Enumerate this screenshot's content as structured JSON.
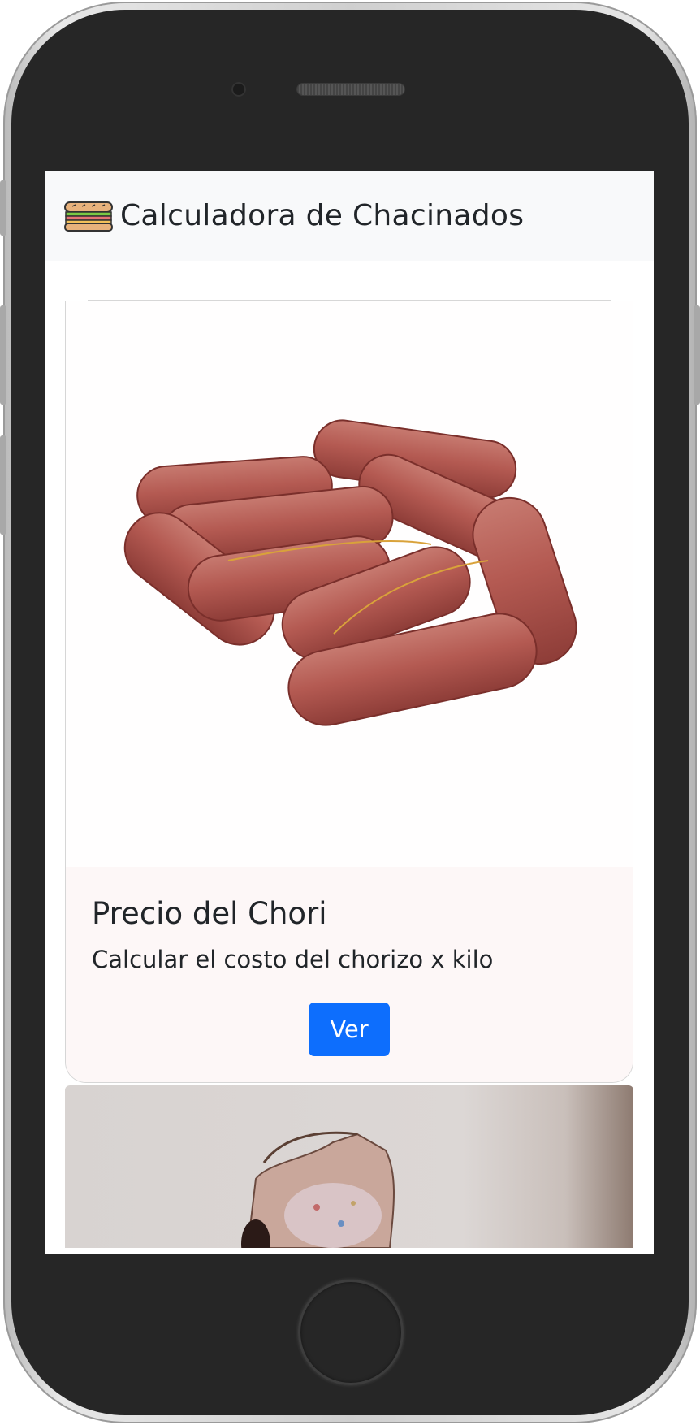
{
  "app": {
    "brand_icon": "sandwich-icon",
    "title": "Calculadora de Chacinados"
  },
  "cards": [
    {
      "image": "chorizo-sausages-image",
      "title": "Precio del Chori",
      "text": "Calcular el costo del chorizo x kilo",
      "button_label": "Ver"
    },
    {
      "image": "cured-meat-image"
    }
  ],
  "colors": {
    "navbar_bg": "#f8f9fa",
    "button_bg": "#0d6efd",
    "text": "#212529"
  }
}
